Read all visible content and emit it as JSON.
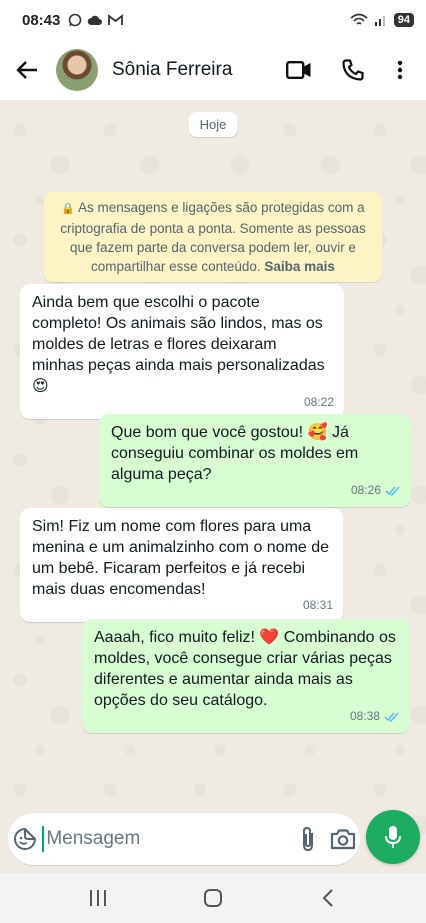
{
  "status_bar": {
    "time": "08:43",
    "battery": "94"
  },
  "header": {
    "contact_name": "Sônia Ferreira"
  },
  "chat": {
    "date_chip": "Hoje",
    "e2e_notice": {
      "text": "As mensagens e ligações são protegidas com a criptografia de ponta a ponta. Somente as pessoas que fazem parte da conversa podem ler, ouvir e compartilhar esse conteúdo.",
      "link": "Saiba mais"
    },
    "messages": [
      {
        "direction": "incoming",
        "text": "Ainda bem que escolhi o pacote completo! Os animais são lindos, mas os moldes de letras e flores deixaram minhas peças ainda mais personalizadas 😍",
        "time": "08:22"
      },
      {
        "direction": "outgoing",
        "text": "Que bom que você gostou! 🥰 Já conseguiu combinar os moldes em alguma peça?",
        "time": "08:26",
        "status": "read"
      },
      {
        "direction": "incoming",
        "text": "Sim! Fiz um nome com flores para uma menina e um animalzinho com o nome de um bebê. Ficaram perfeitos e já recebi mais duas encomendas!",
        "time": "08:31"
      },
      {
        "direction": "outgoing",
        "text": "Aaaah, fico muito feliz! ❤️ Combinando os moldes, você consegue criar várias peças diferentes e aumentar ainda mais as opções do seu catálogo.",
        "time": "08:38",
        "status": "read"
      }
    ]
  },
  "composer": {
    "placeholder": "Mensagem"
  },
  "colors": {
    "accent": "#1daa61",
    "outgoing_bubble": "#d9fdd3",
    "read_tick": "#53bdeb",
    "notice_bg": "#fdf4c5"
  }
}
